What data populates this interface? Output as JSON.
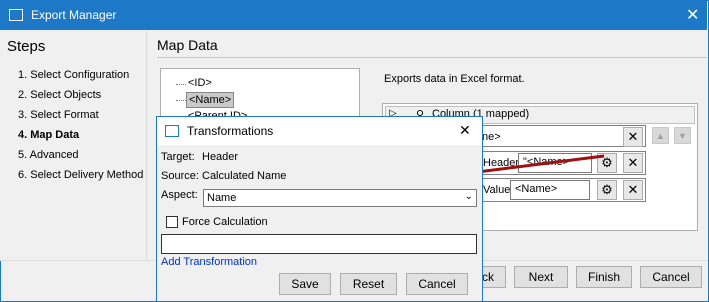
{
  "window": {
    "title": "Export Manager",
    "close_glyph": "✕"
  },
  "steps": {
    "title": "Steps",
    "items": [
      "1. Select Configuration",
      "2. Select Objects",
      "3. Select Format",
      "4. Map Data",
      "5. Advanced",
      "6. Select Delivery Method"
    ],
    "active_index": 3
  },
  "content": {
    "title": "Map Data",
    "description": "Exports data in Excel format.",
    "tree": [
      "<ID>",
      "<Name>",
      "<Parent ID>"
    ],
    "mapping": {
      "column_header": "Column (1 mapped)",
      "row1_text": "ne>",
      "row2_label": "Header",
      "row2_value": "\"<Name>",
      "row3_label": "Value",
      "row3_value": "<Name>"
    }
  },
  "buttons": {
    "back": "ck",
    "next": "Next",
    "finish": "Finish",
    "cancel": "Cancel"
  },
  "dialog": {
    "title": "Transformations",
    "target_label": "Target:",
    "target_value": "Header",
    "source_label": "Source:",
    "source_value": "Calculated Name",
    "aspect_label": "Aspect:",
    "aspect_value": "Name",
    "force_label": "Force Calculation",
    "expression_value": "",
    "add_link": "Add Transformation",
    "save": "Save",
    "reset": "Reset",
    "cancel": "Cancel"
  },
  "colors": {
    "accent": "#1e78c8",
    "arrow": "#a01010",
    "link": "#0033cc"
  }
}
